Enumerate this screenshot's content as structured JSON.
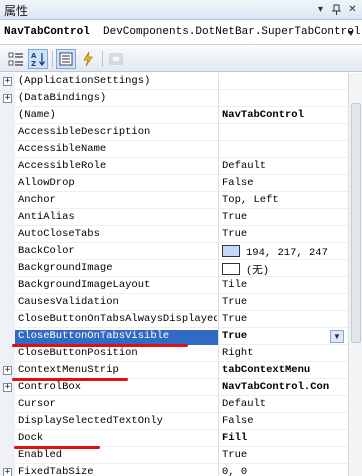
{
  "window": {
    "title": "属性"
  },
  "object_selector": {
    "name": "NavTabControl",
    "type": "DevComponents.DotNetBar.SuperTabControl"
  },
  "toolbar": {
    "buttons": [
      {
        "icon": "categorized-icon"
      },
      {
        "icon": "alphabetical-icon"
      },
      {
        "icon": "properties-icon"
      },
      {
        "icon": "events-icon"
      },
      {
        "icon": "property-pages-icon"
      }
    ]
  },
  "properties": [
    {
      "expand": "+",
      "name": "(ApplicationSettings)",
      "value": ""
    },
    {
      "expand": "+",
      "name": "(DataBindings)",
      "value": ""
    },
    {
      "expand": "",
      "name": "(Name)",
      "value": "NavTabControl",
      "bold": true
    },
    {
      "expand": "",
      "name": "AccessibleDescription",
      "value": ""
    },
    {
      "expand": "",
      "name": "AccessibleName",
      "value": ""
    },
    {
      "expand": "",
      "name": "AccessibleRole",
      "value": "Default"
    },
    {
      "expand": "",
      "name": "AllowDrop",
      "value": "False"
    },
    {
      "expand": "",
      "name": "Anchor",
      "value": "Top, Left"
    },
    {
      "expand": "",
      "name": "AntiAlias",
      "value": "True"
    },
    {
      "expand": "",
      "name": "AutoCloseTabs",
      "value": "True"
    },
    {
      "expand": "",
      "name": "BackColor",
      "value": "194, 217, 247",
      "swatch": "#c2d9f7"
    },
    {
      "expand": "",
      "name": "BackgroundImage",
      "value": "(无)",
      "swatch": "#ffffff"
    },
    {
      "expand": "",
      "name": "BackgroundImageLayout",
      "value": "Tile"
    },
    {
      "expand": "",
      "name": "CausesValidation",
      "value": "True"
    },
    {
      "expand": "",
      "name": "CloseButtonOnTabsAlwaysDisplayed",
      "value": "True"
    },
    {
      "expand": "",
      "name": "CloseButtonOnTabsVisible",
      "value": "True",
      "selected": true
    },
    {
      "expand": "",
      "name": "CloseButtonPosition",
      "value": "Right"
    },
    {
      "expand": "+",
      "name": "ContextMenuStrip",
      "value": "tabContextMenu",
      "bold": true
    },
    {
      "expand": "+",
      "name": "ControlBox",
      "value": "NavTabControl.Con",
      "bold": true
    },
    {
      "expand": "",
      "name": "Cursor",
      "value": "Default"
    },
    {
      "expand": "",
      "name": "DisplaySelectedTextOnly",
      "value": "False"
    },
    {
      "expand": "",
      "name": "Dock",
      "value": "Fill",
      "bold": true
    },
    {
      "expand": "",
      "name": "Enabled",
      "value": "True"
    },
    {
      "expand": "+",
      "name": "FixedTabSize",
      "value": "0, 0"
    }
  ],
  "colors": {
    "selection": "#316ac5",
    "annotation": "#dd1111"
  }
}
